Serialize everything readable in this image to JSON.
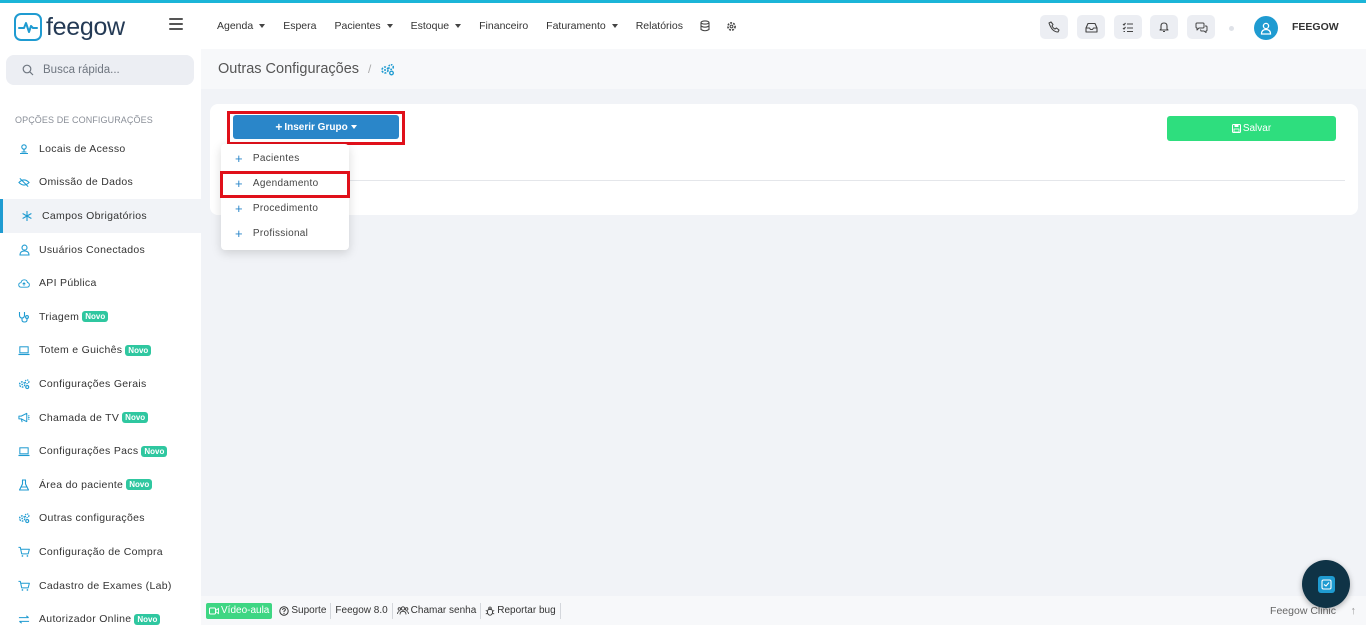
{
  "app": {
    "logo_text": "feegow"
  },
  "colors": {
    "brand": "#1f9bd1",
    "insert_button": "#2a86c9",
    "save_button": "#2ede7e",
    "badge": "#2fc7a0",
    "highlight": "#e0101a",
    "top_stripe": "#1bb5d8"
  },
  "nav": {
    "items": [
      {
        "label": "Agenda",
        "dropdown": true
      },
      {
        "label": "Espera",
        "dropdown": false
      },
      {
        "label": "Pacientes",
        "dropdown": true
      },
      {
        "label": "Estoque",
        "dropdown": true
      },
      {
        "label": "Financeiro",
        "dropdown": false
      },
      {
        "label": "Faturamento",
        "dropdown": true
      },
      {
        "label": "Relatórios",
        "dropdown": false
      }
    ],
    "icons": [
      "database-icon",
      "gear-icon"
    ]
  },
  "topbar": {
    "buttons": [
      "phone-icon",
      "inbox-icon",
      "task-list-icon",
      "bell-icon",
      "chat-icon"
    ],
    "user_name": "FEEGOW"
  },
  "search": {
    "placeholder": "Busca rápida..."
  },
  "sidebar": {
    "heading": "OPÇÕES DE CONFIGURAÇÕES",
    "items": [
      {
        "label": "Locais de Acesso",
        "icon": "map-pin-icon"
      },
      {
        "label": "Omissão de Dados",
        "icon": "eye-off-icon"
      },
      {
        "label": "Campos Obrigatórios",
        "icon": "asterisk-icon",
        "active": true
      },
      {
        "label": "Usuários Conectados",
        "icon": "user-icon"
      },
      {
        "label": "API Pública",
        "icon": "cloud-upload-icon"
      },
      {
        "label": "Triagem",
        "icon": "stethoscope-icon",
        "badge": "Novo"
      },
      {
        "label": "Totem e Guichês",
        "icon": "laptop-icon",
        "badge": "Novo"
      },
      {
        "label": "Configurações Gerais",
        "icon": "gears-icon"
      },
      {
        "label": "Chamada de TV",
        "icon": "megaphone-icon",
        "badge": "Novo"
      },
      {
        "label": "Configurações Pacs",
        "icon": "laptop-icon",
        "badge": "Novo"
      },
      {
        "label": "Área do paciente",
        "icon": "flask-icon",
        "badge": "Novo"
      },
      {
        "label": "Outras configurações",
        "icon": "gears-icon"
      },
      {
        "label": "Configuração de Compra",
        "icon": "cart-icon"
      },
      {
        "label": "Cadastro de Exames (Lab)",
        "icon": "cart-icon"
      },
      {
        "label": "Autorizador Online",
        "icon": "transfer-icon",
        "badge": "Novo"
      }
    ]
  },
  "page": {
    "title": "Outras Configurações",
    "separator": "/",
    "breadcrumb_icon": "gears-icon"
  },
  "panel": {
    "insert_button": "Inserir Grupo",
    "save_button": "Salvar",
    "dropdown": [
      "Pacientes",
      "Agendamento",
      "Procedimento",
      "Profissional"
    ]
  },
  "footer": {
    "video": "Vídeo-aula",
    "support": "Suporte",
    "version": "Feegow 8.0",
    "call": "Chamar senha",
    "bug": "Reportar bug",
    "brand": "Feegow Clinic"
  }
}
